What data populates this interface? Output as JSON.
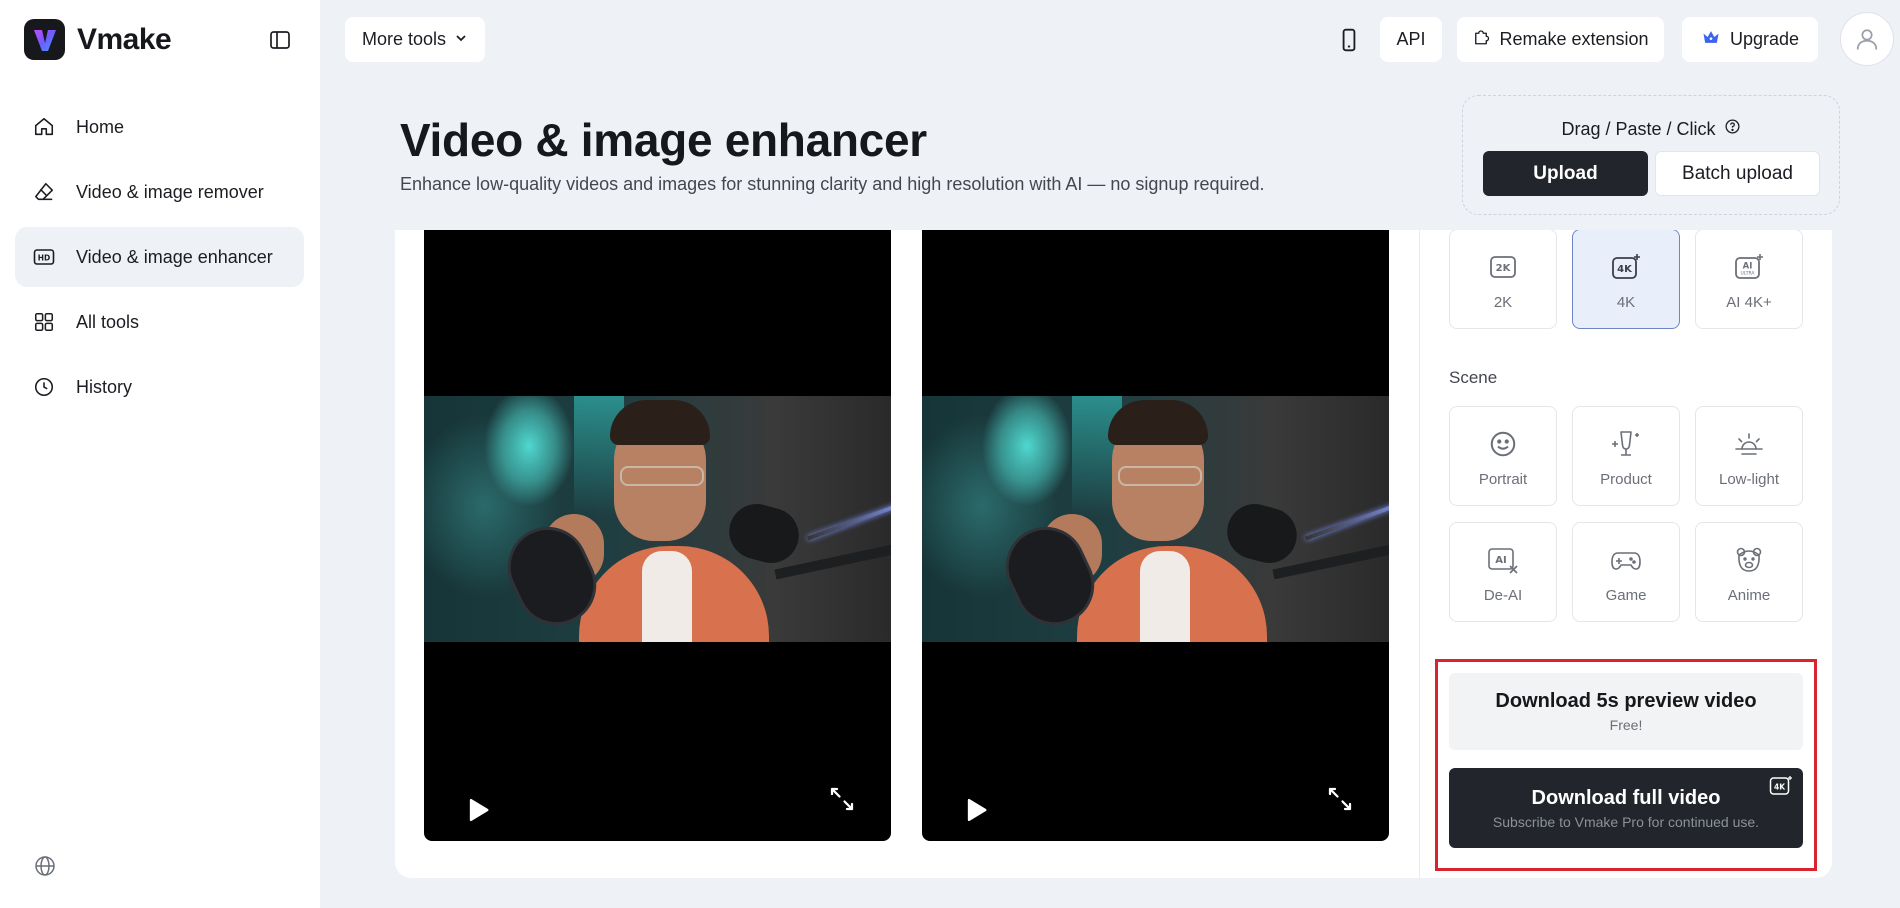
{
  "app": {
    "name": "Vmake",
    "brand_color": "#7b3cff"
  },
  "sidebar": {
    "items": [
      {
        "label": "Home",
        "icon": "home-icon"
      },
      {
        "label": "Video & image remover",
        "icon": "eraser-icon"
      },
      {
        "label": "Video & image enhancer",
        "icon": "hd-icon",
        "active": true
      },
      {
        "label": "All tools",
        "icon": "grid-icon"
      },
      {
        "label": "History",
        "icon": "clock-icon"
      }
    ]
  },
  "topbar": {
    "more_tools": "More tools",
    "api": "API",
    "extension": "Remake extension",
    "upgrade": "Upgrade"
  },
  "header": {
    "title": "Video & image enhancer",
    "subtitle": "Enhance low-quality videos and images for stunning clarity and high resolution with AI — no signup required."
  },
  "upload": {
    "hint": "Drag / Paste / Click",
    "upload_label": "Upload",
    "batch_label": "Batch upload"
  },
  "resolution": {
    "options": [
      {
        "label": "2K",
        "icon": "2k-icon",
        "selected": false
      },
      {
        "label": "4K",
        "icon": "4k-icon",
        "selected": true
      },
      {
        "label": "AI 4K+",
        "icon": "ai-ultra-icon",
        "selected": false
      }
    ]
  },
  "scene": {
    "label": "Scene",
    "options": [
      {
        "label": "Portrait",
        "icon": "smile-icon"
      },
      {
        "label": "Product",
        "icon": "product-icon"
      },
      {
        "label": "Low-light",
        "icon": "sunset-icon"
      },
      {
        "label": "De-AI",
        "icon": "de-ai-icon"
      },
      {
        "label": "Game",
        "icon": "gamepad-icon"
      },
      {
        "label": "Anime",
        "icon": "bear-icon"
      }
    ]
  },
  "download": {
    "preview_title": "Download 5s preview video",
    "preview_sub": "Free!",
    "full_title": "Download full video",
    "full_sub": "Subscribe to Vmake Pro for continued use.",
    "highlight_color": "#d8242e"
  }
}
